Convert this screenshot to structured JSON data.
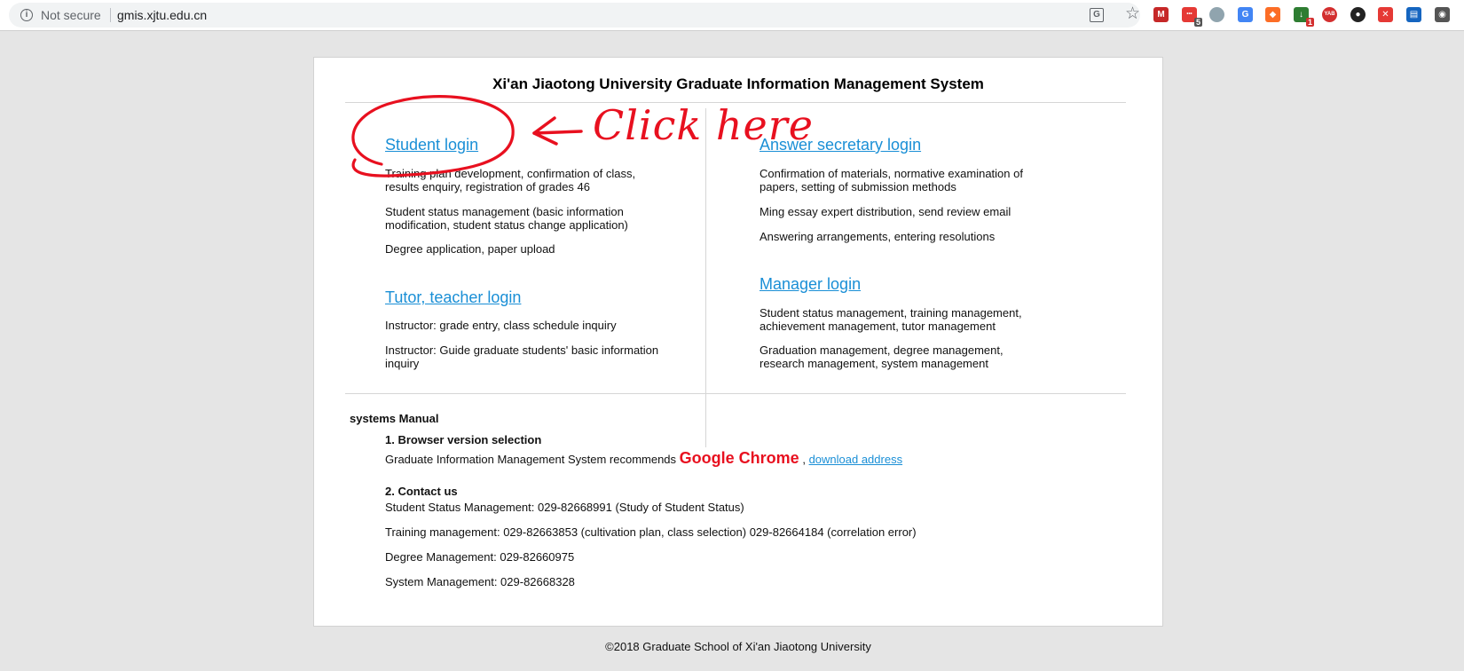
{
  "browser": {
    "security_label": "Not secure",
    "url": "gmis.xjtu.edu.cn",
    "extensions": [
      {
        "name": "mega-extension-icon",
        "color": "#c62828",
        "glyph": "M"
      },
      {
        "name": "todo-extension-icon",
        "color": "#e53935",
        "glyph": "•••",
        "badge": "5",
        "badge_color": "#555555"
      },
      {
        "name": "circle-extension-icon",
        "color": "#90a4ae",
        "glyph": ""
      },
      {
        "name": "google-translate-extension-icon",
        "color": "#4285f4",
        "glyph": "G"
      },
      {
        "name": "gitlab-extension-icon",
        "color": "#fc6d26",
        "glyph": "◆"
      },
      {
        "name": "green-extension-icon",
        "color": "#2e7d32",
        "glyph": "↓",
        "badge": "1",
        "badge_color": "#d32f2f"
      },
      {
        "name": "yab-extension-icon",
        "color": "#d32f2f",
        "glyph": "YAB"
      },
      {
        "name": "github-extension-icon",
        "color": "#222222",
        "glyph": "●"
      },
      {
        "name": "ublock-extension-icon",
        "color": "#e53935",
        "glyph": "✕"
      },
      {
        "name": "reader-extension-icon",
        "color": "#1565c0",
        "glyph": "▤"
      },
      {
        "name": "line-extension-icon",
        "color": "#555555",
        "glyph": "◉"
      }
    ]
  },
  "page": {
    "title": "Xi'an Jiaotong University Graduate Information Management System",
    "student": {
      "link": "Student login",
      "items": [
        "Training plan development, confirmation of class, results enquiry, registration of grades 46",
        "Student status management (basic information modification, student status change application)",
        "Degree application, paper upload"
      ]
    },
    "tutor": {
      "link": "Tutor, teacher login",
      "items": [
        "Instructor: grade entry, class schedule inquiry",
        "Instructor: Guide graduate students' basic information inquiry"
      ]
    },
    "secretary": {
      "link": "Answer secretary login",
      "items": [
        "Confirmation of materials, normative examination of papers, setting of submission methods",
        "Ming essay expert distribution, send review email",
        "Answering arrangements, entering resolutions"
      ]
    },
    "manager": {
      "link": "Manager login",
      "items": [
        "Student status management, training management, achievement management, tutor management",
        "Graduation management, degree management, research management, system management"
      ]
    },
    "manual": {
      "title": "systems Manual",
      "browser_section": {
        "title": "1. Browser version selection",
        "text": "Graduate Information Management System recommends",
        "highlight": "Google Chrome",
        "separator": ",",
        "link": "download address"
      },
      "contact_section": {
        "title": "2. Contact us",
        "lines": [
          "Student Status Management: 029-82668991 (Study of Student Status)",
          "Training management: 029-82663853 (cultivation plan, class selection) 029-82664184 (correlation error)",
          "Degree Management: 029-82660975",
          "System Management: 029-82668328"
        ]
      }
    },
    "footer": "©2018 Graduate School of Xi'an Jiaotong University"
  },
  "annotation": {
    "text": "Click here",
    "color": "#e8101f"
  }
}
